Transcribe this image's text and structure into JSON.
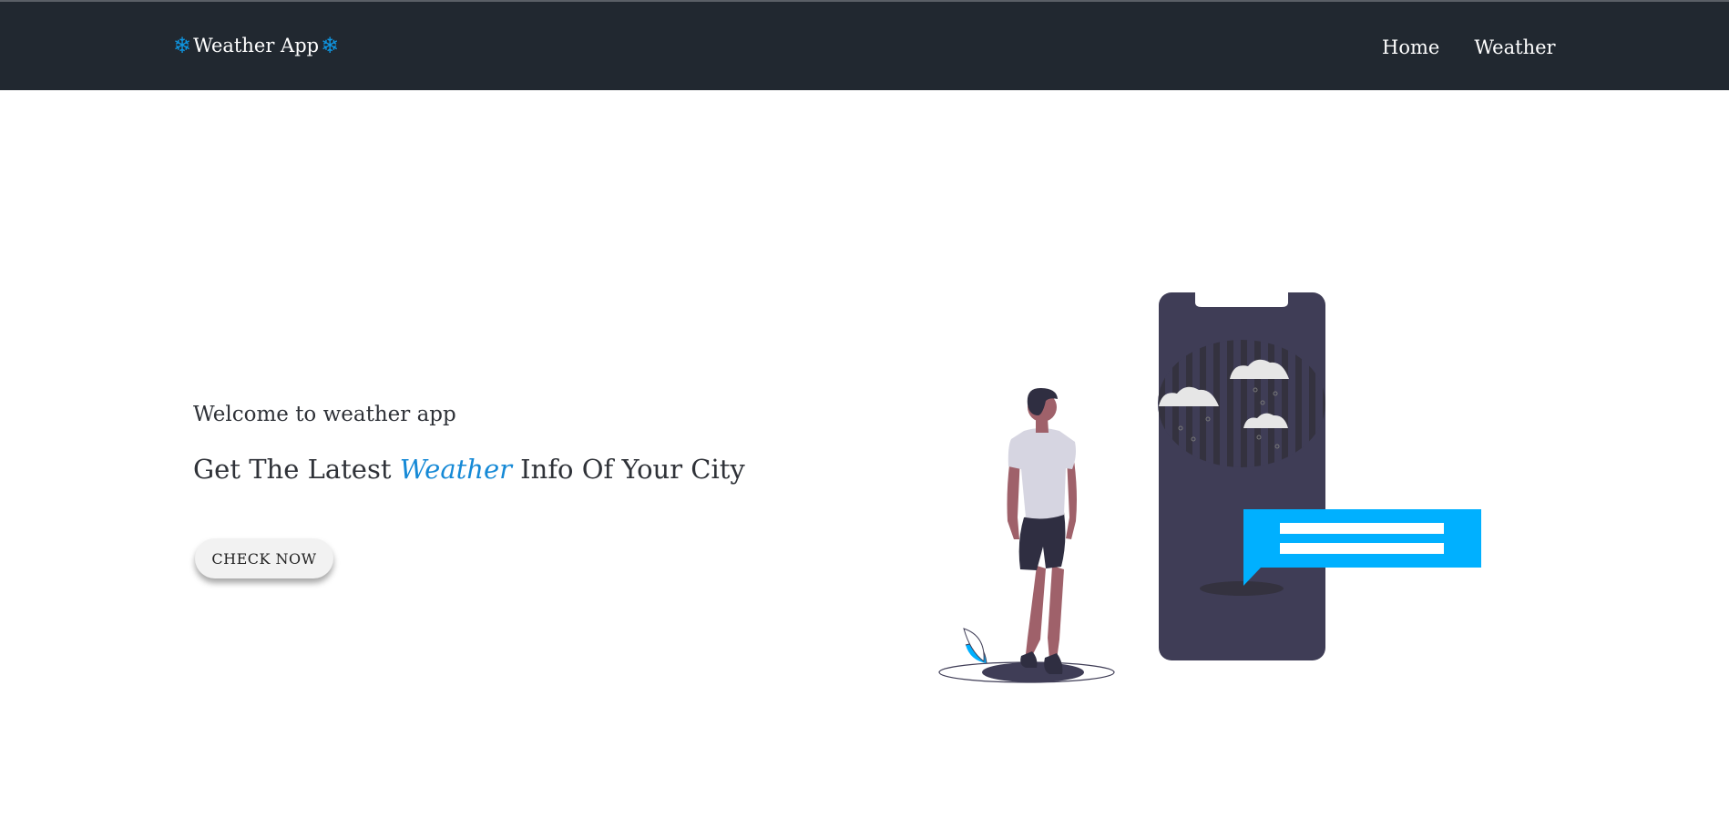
{
  "navbar": {
    "brand": {
      "icon_left": "❄",
      "title": "Weather App",
      "icon_right": "❄",
      "icon_name": "snowflake-icon"
    },
    "links": [
      {
        "label": "Home"
      },
      {
        "label": "Weather"
      }
    ]
  },
  "hero": {
    "welcome": "Welcome to weather app",
    "headline_before": "Get The Latest ",
    "headline_accent": "Weather",
    "headline_after": " Info Of Your City",
    "button_label": "CHECK NOW"
  },
  "colors": {
    "navbar_bg": "#212830",
    "accent": "#1589d6",
    "illustration_accent": "#00b0ff",
    "phone": "#3f3d56"
  }
}
